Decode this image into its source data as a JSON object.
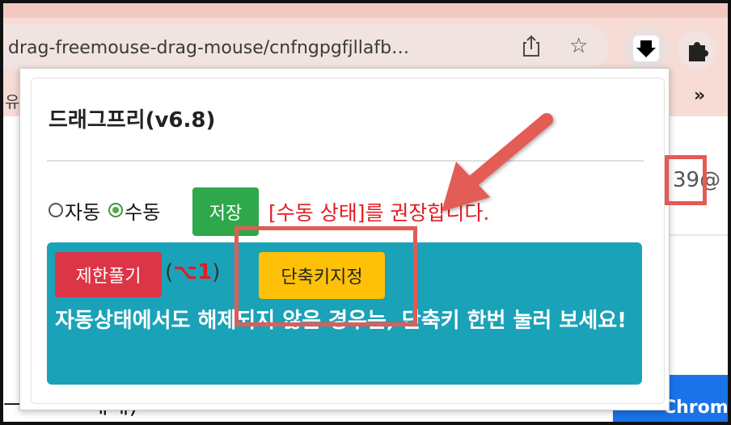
{
  "browser": {
    "url_text": "drag-freemouse-drag-mouse/cnfngpgfjllafb…",
    "bookmark_overflow": "»",
    "left_clip_text": "유",
    "page_right_text": "39@",
    "chrome_button_text": "Chrom",
    "bottom_clip_text": "ㅡ ㅂ ㄹ 에제)"
  },
  "popup": {
    "title": "드래그프리(v6.8)",
    "mode": {
      "auto_label": "자동",
      "manual_label": "수동",
      "selected": "manual"
    },
    "save_label": "저장",
    "recommend_text": "[수동 상태]를 권장합니다.",
    "unlock_label": "제한풀기",
    "shortcut_open": "(",
    "shortcut_key": "⌥1",
    "shortcut_close": ")",
    "assign_shortcut_label": "단축키지정",
    "info_text": "자동상태에서도 해제되지 않은 경우는, 단축키 한번 눌러 보세요!"
  },
  "colors": {
    "save": "#2ea84a",
    "unlock": "#dc3545",
    "assign": "#ffc107",
    "info_box": "#1aa2b8",
    "highlight": "#e35b55",
    "recommend_text": "#e31b23"
  },
  "icons": [
    "share-icon",
    "star-icon",
    "drag-extension-icon",
    "puzzle-icon"
  ]
}
